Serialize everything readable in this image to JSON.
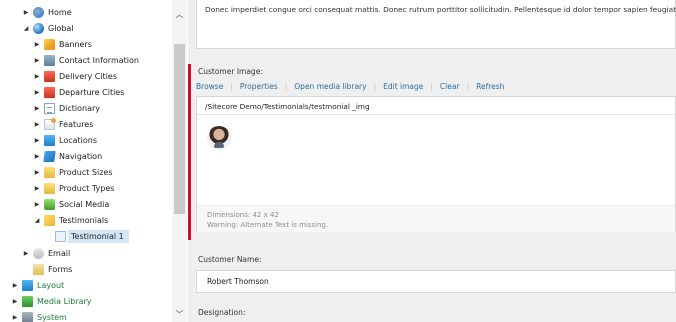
{
  "tree": {
    "items": [
      {
        "label": "Home",
        "icon": "home-icon"
      },
      {
        "label": "Global",
        "icon": "globe-icon"
      },
      {
        "label": "Banners",
        "icon": "folder-banners-icon"
      },
      {
        "label": "Contact Information",
        "icon": "contact-card-icon"
      },
      {
        "label": "Delivery Cities",
        "icon": "delivery-cities-icon"
      },
      {
        "label": "Departure Cities",
        "icon": "departure-cities-icon"
      },
      {
        "label": "Dictionary",
        "icon": "dictionary-icon"
      },
      {
        "label": "Features",
        "icon": "features-icon"
      },
      {
        "label": "Locations",
        "icon": "locations-icon"
      },
      {
        "label": "Navigation",
        "icon": "navigation-icon"
      },
      {
        "label": "Product Sizes",
        "icon": "folder-icon"
      },
      {
        "label": "Product Types",
        "icon": "folder-icon"
      },
      {
        "label": "Social Media",
        "icon": "social-media-icon"
      },
      {
        "label": "Testimonials",
        "icon": "testimonials-icon"
      },
      {
        "label": "Testimonial 1",
        "icon": "testimonial-item-icon"
      },
      {
        "label": "Email",
        "icon": "email-icon"
      },
      {
        "label": "Forms",
        "icon": "forms-icon"
      },
      {
        "label": "Layout",
        "icon": "layout-icon"
      },
      {
        "label": "Media Library",
        "icon": "media-library-icon"
      },
      {
        "label": "System",
        "icon": "system-icon"
      }
    ]
  },
  "content": {
    "previous_field_text": "Donec imperdiet congue orci consequat mattis. Donec rutrum porttitor sollicitudin. Pellentesque id dolor tempor sapien feugiat ultrices.",
    "image_field": {
      "label": "Customer Image:",
      "links": [
        "Browse",
        "Properties",
        "Open media library",
        "Edit image",
        "Clear",
        "Refresh"
      ],
      "path": "/Sitecore Demo/Testimonials/testmonial _img",
      "dimensions": "Dimensions: 42 x 42",
      "warning": "Warning: Alternate Text is missing."
    },
    "name_field": {
      "label": "Customer Name:",
      "value": "Robert Thomson"
    },
    "designation_label": "Designation:"
  },
  "colors": {
    "required_marker": "#c8102e",
    "link": "#2b6ca3",
    "selected_bg": "#d3e6f5",
    "green_text": "#1e7a3a"
  }
}
